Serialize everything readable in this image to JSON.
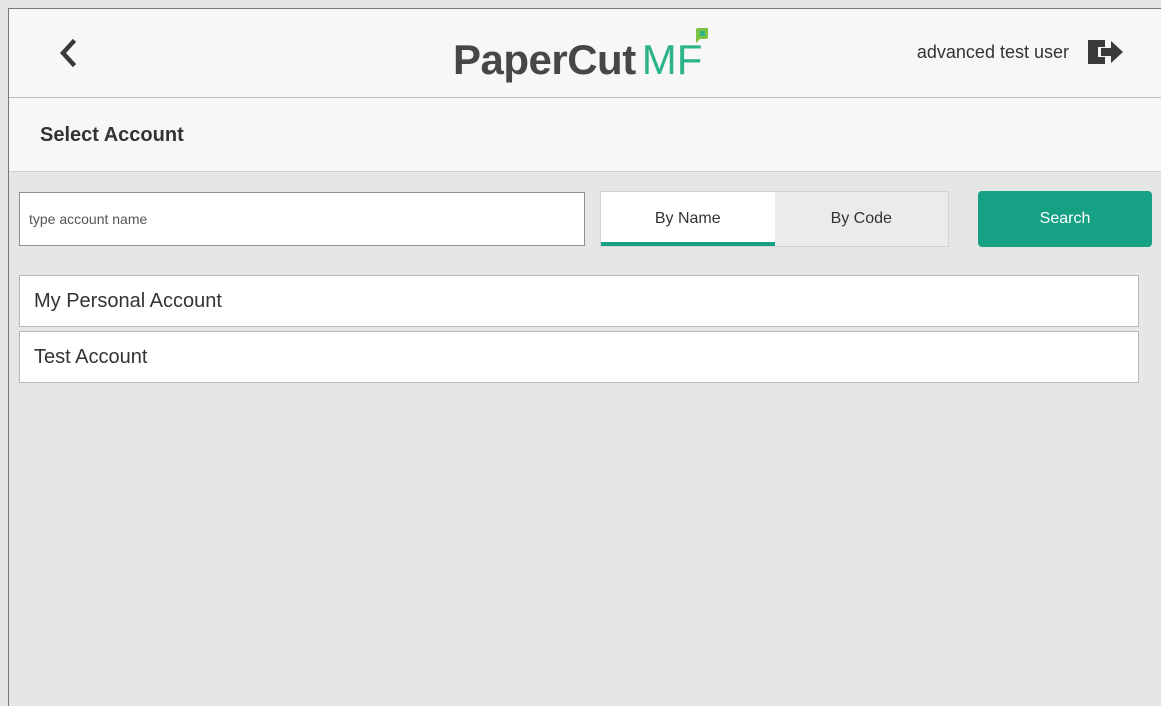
{
  "header": {
    "back_icon": "chevron-left-icon",
    "logo": {
      "main": "PaperCut",
      "accent": "MF",
      "accent_color": "#2db38a"
    },
    "user_name": "advanced test user",
    "logout_icon": "logout-icon"
  },
  "page": {
    "title": "Select Account"
  },
  "search": {
    "placeholder": "type account name",
    "value": "",
    "toggle": {
      "by_name_label": "By Name",
      "by_code_label": "By Code",
      "selected": "By Name"
    },
    "search_label": "Search",
    "accent_color": "#16a084"
  },
  "accounts": [
    {
      "label": "My Personal Account"
    },
    {
      "label": "Test Account"
    }
  ]
}
